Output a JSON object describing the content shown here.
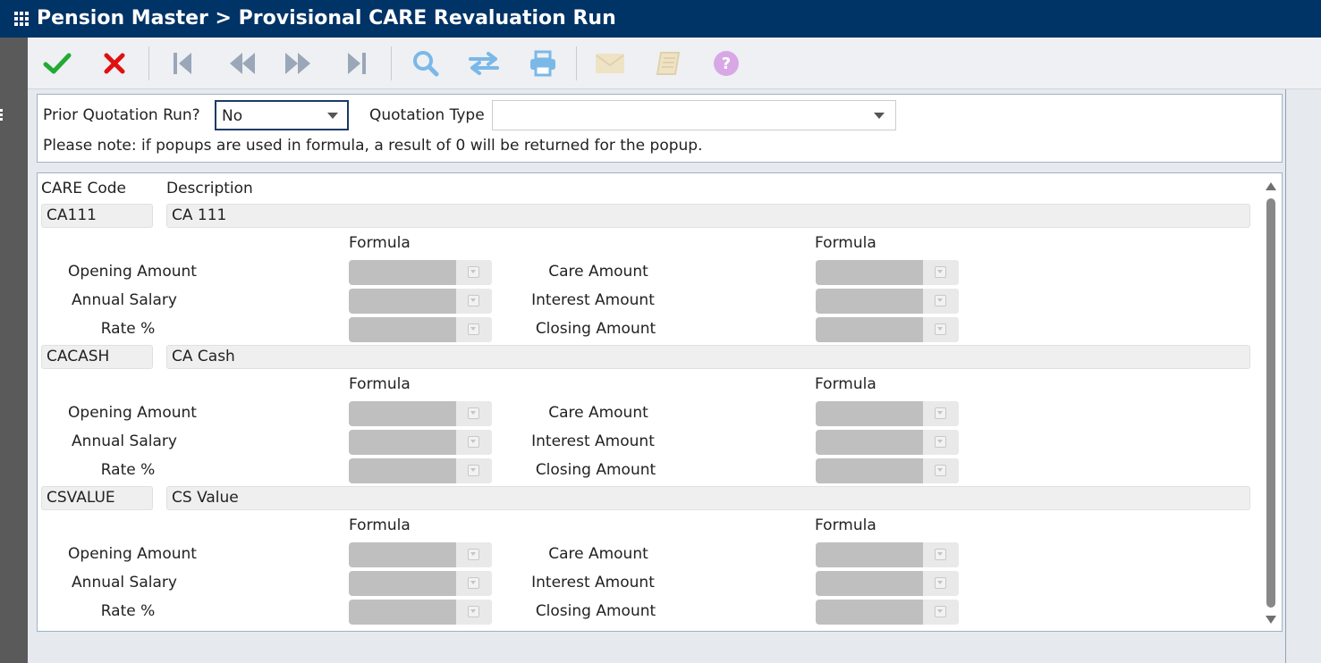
{
  "window": {
    "title": "Pension Master > Provisional CARE Revaluation Run"
  },
  "toolbar": {
    "buttons": [
      {
        "name": "confirm-button",
        "icon": "checkmark-icon",
        "color": "#22aa33"
      },
      {
        "name": "cancel-button",
        "icon": "close-icon",
        "color": "#e01010"
      },
      {
        "name": "first-record-button",
        "icon": "first-icon",
        "color": "#9aa7b8"
      },
      {
        "name": "previous-record-button",
        "icon": "rewind-icon",
        "color": "#9aa7b8"
      },
      {
        "name": "next-record-button",
        "icon": "fast-forward-icon",
        "color": "#9aa7b8"
      },
      {
        "name": "last-record-button",
        "icon": "last-icon",
        "color": "#9aa7b8"
      },
      {
        "name": "search-button",
        "icon": "search-icon",
        "color": "#7ab8e8"
      },
      {
        "name": "transfer-button",
        "icon": "swap-arrows-icon",
        "color": "#7ab8e8"
      },
      {
        "name": "print-button",
        "icon": "printer-icon",
        "color": "#7ab8e8"
      },
      {
        "name": "email-button",
        "icon": "envelope-icon",
        "color": "#efe3c6"
      },
      {
        "name": "notes-button",
        "icon": "notebook-icon",
        "color": "#efe3c6"
      },
      {
        "name": "help-button",
        "icon": "question-icon",
        "color": "#d8a8e6"
      }
    ]
  },
  "filters": {
    "prior_quotation_label": "Prior Quotation Run?",
    "prior_quotation_value": "No",
    "quotation_type_label": "Quotation Type",
    "quotation_type_value": "",
    "note": "Please note: if popups are used in formula, a result of 0 will be returned for the popup."
  },
  "grid": {
    "code_header": "CARE Code",
    "description_header": "Description",
    "formula_header": "Formula",
    "left_labels": [
      "Opening Amount",
      "Annual Salary",
      "Rate %"
    ],
    "right_labels": [
      "Care Amount",
      "Interest Amount",
      "Closing Amount"
    ],
    "rows": [
      {
        "code": "CA111",
        "description": "CA 111"
      },
      {
        "code": "CACASH",
        "description": "CA Cash"
      },
      {
        "code": "CSVALUE",
        "description": "CS Value"
      }
    ]
  }
}
